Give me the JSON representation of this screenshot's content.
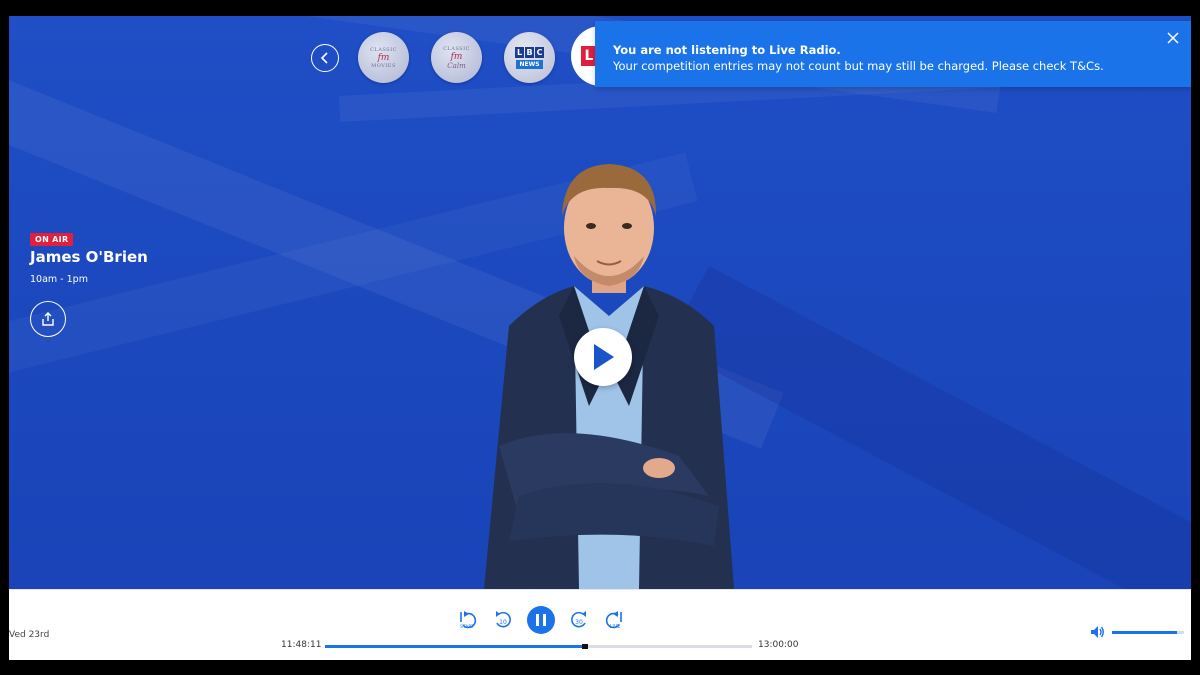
{
  "notice": {
    "title": "You are not listening to Live Radio.",
    "body": "Your competition entries may not count but may still be charged. Please check T&Cs."
  },
  "stations": [
    {
      "name": "Classic FM Movies",
      "sub": "CLASSIC",
      "main": "fm",
      "tag": "MOVIES"
    },
    {
      "name": "Classic FM Calm",
      "sub": "CLASSIC",
      "main": "fm",
      "tag": "Calm"
    },
    {
      "name": "LBC News",
      "letters": [
        "L",
        "B",
        "C"
      ],
      "tag": "NEWS"
    },
    {
      "name": "LBC",
      "letter": "L"
    }
  ],
  "show": {
    "badge": "ON AIR",
    "host": "James O'Brien",
    "time": "10am - 1pm"
  },
  "player": {
    "date": "Ved 23rd",
    "elapsed": "11:48:11",
    "end": "13:00:00",
    "progress_fraction": 0.61,
    "volume_fraction": 0.9,
    "skip_back": "10",
    "skip_forward": "30",
    "start_label": "START",
    "live_label": "LIVE"
  },
  "colors": {
    "background": "#1f4ec6",
    "accent": "#1a73e8",
    "on_air": "#e0203c"
  }
}
